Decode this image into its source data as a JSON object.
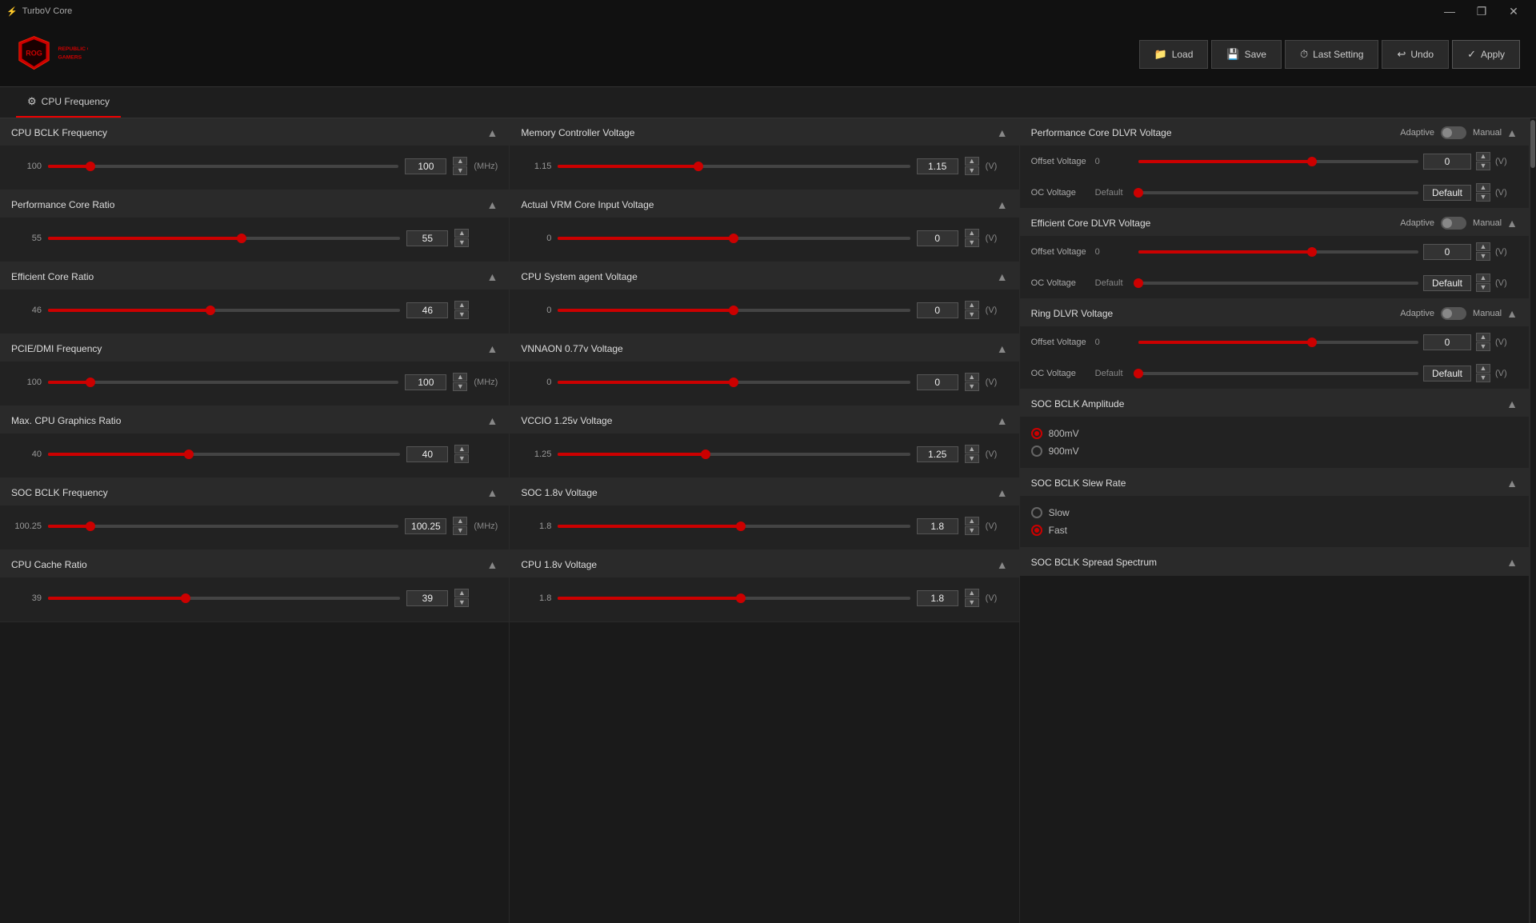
{
  "app": {
    "title": "TurboV Core",
    "titlebar_icon": "⚡"
  },
  "titlebar": {
    "minimize": "—",
    "restore": "❐",
    "close": "✕"
  },
  "header": {
    "buttons": {
      "load": "Load",
      "save": "Save",
      "last_setting": "Last Setting",
      "undo": "Undo",
      "apply": "Apply"
    }
  },
  "tab": {
    "label": "CPU Frequency"
  },
  "left_column": {
    "sections": [
      {
        "id": "cpu_bclk",
        "title": "CPU BCLK Frequency",
        "value": 100,
        "display": "100",
        "unit": "(MHz)",
        "fill_pct": 12
      },
      {
        "id": "perf_core_ratio",
        "title": "Performance Core Ratio",
        "value": 55,
        "display": "55",
        "unit": "",
        "fill_pct": 55
      },
      {
        "id": "eff_core_ratio",
        "title": "Efficient Core Ratio",
        "value": 46,
        "display": "46",
        "unit": "",
        "fill_pct": 46
      },
      {
        "id": "pcie_dmi",
        "title": "PCIE/DMI Frequency",
        "value": 100,
        "display": "100",
        "unit": "(MHz)",
        "fill_pct": 12
      },
      {
        "id": "max_cpu_gfx",
        "title": "Max. CPU Graphics Ratio",
        "value": 40,
        "display": "40",
        "unit": "",
        "fill_pct": 40
      },
      {
        "id": "soc_bclk_freq",
        "title": "SOC BCLK Frequency",
        "value": 100.25,
        "display": "100.25",
        "unit": "(MHz)",
        "fill_pct": 12
      },
      {
        "id": "cpu_cache",
        "title": "CPU Cache Ratio",
        "value": 39,
        "display": "39",
        "unit": "",
        "fill_pct": 39
      }
    ]
  },
  "mid_column": {
    "sections": [
      {
        "id": "mem_ctrl_v",
        "title": "Memory Controller Voltage",
        "value": 1.15,
        "display": "1.15",
        "unit": "(V)",
        "fill_pct": 40
      },
      {
        "id": "actual_vrm",
        "title": "Actual VRM Core Input Voltage",
        "value": 0,
        "display": "0",
        "unit": "(V)",
        "fill_pct": 50
      },
      {
        "id": "cpu_sys_agent",
        "title": "CPU System agent Voltage",
        "value": 0,
        "display": "0",
        "unit": "(V)",
        "fill_pct": 50
      },
      {
        "id": "vnnaon",
        "title": "VNNAON 0.77v Voltage",
        "value": 0,
        "display": "0",
        "unit": "(V)",
        "fill_pct": 50
      },
      {
        "id": "vccio_125",
        "title": "VCCIO 1.25v Voltage",
        "value": 1.25,
        "display": "1.25",
        "unit": "(V)",
        "fill_pct": 42
      },
      {
        "id": "soc_18v",
        "title": "SOC 1.8v Voltage",
        "value": 1.8,
        "display": "1.8",
        "unit": "(V)",
        "fill_pct": 52
      },
      {
        "id": "cpu_18v",
        "title": "CPU 1.8v Voltage",
        "value": 1.8,
        "display": "1.8",
        "unit": "(V)",
        "fill_pct": 52
      }
    ]
  },
  "right_column": {
    "sections": [
      {
        "id": "perf_dlvr",
        "title": "Performance Core DLVR Voltage",
        "adaptive_label": "Adaptive",
        "manual_label": "Manual",
        "subsections": [
          {
            "label": "Offset Voltage",
            "min_label": "0",
            "value": 0,
            "display": "0",
            "unit": "(V)",
            "fill_pct": 62
          },
          {
            "label": "OC Voltage",
            "min_label": "Default",
            "value": "Default",
            "display": "Default",
            "unit": "(V)",
            "fill_pct": 0
          }
        ]
      },
      {
        "id": "eff_dlvr",
        "title": "Efficient Core DLVR Voltage",
        "adaptive_label": "Adaptive",
        "manual_label": "Manual",
        "subsections": [
          {
            "label": "Offset Voltage",
            "min_label": "0",
            "value": 0,
            "display": "0",
            "unit": "(V)",
            "fill_pct": 62
          },
          {
            "label": "OC Voltage",
            "min_label": "Default",
            "value": "Default",
            "display": "Default",
            "unit": "(V)",
            "fill_pct": 0
          }
        ]
      },
      {
        "id": "ring_dlvr",
        "title": "Ring DLVR Voltage",
        "adaptive_label": "Adaptive",
        "manual_label": "Manual",
        "subsections": [
          {
            "label": "Offset Voltage",
            "min_label": "0",
            "value": 0,
            "display": "0",
            "unit": "(V)",
            "fill_pct": 62
          },
          {
            "label": "OC Voltage",
            "min_label": "Default",
            "value": "Default",
            "display": "Default",
            "unit": "(V)",
            "fill_pct": 0
          }
        ]
      },
      {
        "id": "soc_bclk_amp",
        "title": "SOC BCLK Amplitude",
        "radios": [
          {
            "label": "800mV",
            "selected": true
          },
          {
            "label": "900mV",
            "selected": false
          }
        ]
      },
      {
        "id": "soc_bclk_slew",
        "title": "SOC BCLK Slew Rate",
        "radios": [
          {
            "label": "Slow",
            "selected": false
          },
          {
            "label": "Fast",
            "selected": true
          }
        ]
      },
      {
        "id": "soc_bclk_spread",
        "title": "SOC BCLK Spread Spectrum"
      }
    ]
  }
}
